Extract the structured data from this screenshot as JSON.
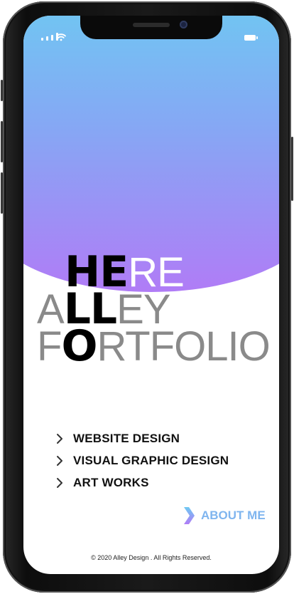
{
  "status": {
    "signal_icon": "signal-icon",
    "wifi_icon": "wifi-icon",
    "battery_icon": "battery-icon"
  },
  "headline": {
    "line1": {
      "bold": "HE",
      "light": "RE"
    },
    "line2": {
      "bold_prefix": "A",
      "bold": "LL",
      "light": "EY"
    },
    "line3": {
      "light_prefix": "F",
      "bold": "O",
      "light": "RTFOLIO"
    }
  },
  "menu": {
    "items": [
      {
        "label": "WEBSITE DESIGN",
        "icon": "chevron-right-icon"
      },
      {
        "label": "VISUAL GRAPHIC DESIGN",
        "icon": "chevron-right-icon"
      },
      {
        "label": "ART WORKS",
        "icon": "chevron-right-icon"
      }
    ]
  },
  "about": {
    "label": "ABOUT ME",
    "icon": "chevron-right-icon"
  },
  "footer": {
    "text": "© 2020 Alley Design . All Rights Reserved."
  },
  "colors": {
    "gradient_top": "#6ec9f2",
    "gradient_bottom": "#b07cf6",
    "about_accent": "#7fb5ef",
    "gray_text": "#8a8a8a"
  }
}
